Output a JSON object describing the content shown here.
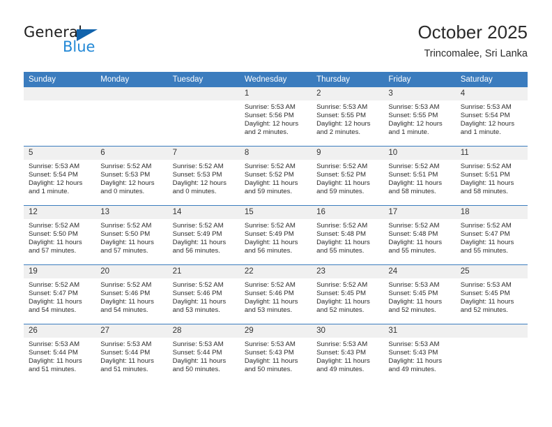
{
  "brand": {
    "name_top": "General",
    "name_bottom": "Blue",
    "accent_color": "#1163ac",
    "accent_color_light": "#2288d6"
  },
  "header": {
    "title": "October 2025",
    "subtitle": "Trincomalee, Sri Lanka"
  },
  "theme": {
    "header_row_bg": "#3b7cbe",
    "daynum_bg": "#f0f0f0",
    "text_color": "#2c2c2c"
  },
  "calendar": {
    "weekday_headers": [
      "Sunday",
      "Monday",
      "Tuesday",
      "Wednesday",
      "Thursday",
      "Friday",
      "Saturday"
    ],
    "weeks": [
      [
        {
          "day": "",
          "sunrise": "",
          "sunset": "",
          "daylight_line1": "",
          "daylight_line2": ""
        },
        {
          "day": "",
          "sunrise": "",
          "sunset": "",
          "daylight_line1": "",
          "daylight_line2": ""
        },
        {
          "day": "",
          "sunrise": "",
          "sunset": "",
          "daylight_line1": "",
          "daylight_line2": ""
        },
        {
          "day": "1",
          "sunrise": "Sunrise: 5:53 AM",
          "sunset": "Sunset: 5:56 PM",
          "daylight_line1": "Daylight: 12 hours",
          "daylight_line2": "and 2 minutes."
        },
        {
          "day": "2",
          "sunrise": "Sunrise: 5:53 AM",
          "sunset": "Sunset: 5:55 PM",
          "daylight_line1": "Daylight: 12 hours",
          "daylight_line2": "and 2 minutes."
        },
        {
          "day": "3",
          "sunrise": "Sunrise: 5:53 AM",
          "sunset": "Sunset: 5:55 PM",
          "daylight_line1": "Daylight: 12 hours",
          "daylight_line2": "and 1 minute."
        },
        {
          "day": "4",
          "sunrise": "Sunrise: 5:53 AM",
          "sunset": "Sunset: 5:54 PM",
          "daylight_line1": "Daylight: 12 hours",
          "daylight_line2": "and 1 minute."
        }
      ],
      [
        {
          "day": "5",
          "sunrise": "Sunrise: 5:53 AM",
          "sunset": "Sunset: 5:54 PM",
          "daylight_line1": "Daylight: 12 hours",
          "daylight_line2": "and 1 minute."
        },
        {
          "day": "6",
          "sunrise": "Sunrise: 5:52 AM",
          "sunset": "Sunset: 5:53 PM",
          "daylight_line1": "Daylight: 12 hours",
          "daylight_line2": "and 0 minutes."
        },
        {
          "day": "7",
          "sunrise": "Sunrise: 5:52 AM",
          "sunset": "Sunset: 5:53 PM",
          "daylight_line1": "Daylight: 12 hours",
          "daylight_line2": "and 0 minutes."
        },
        {
          "day": "8",
          "sunrise": "Sunrise: 5:52 AM",
          "sunset": "Sunset: 5:52 PM",
          "daylight_line1": "Daylight: 11 hours",
          "daylight_line2": "and 59 minutes."
        },
        {
          "day": "9",
          "sunrise": "Sunrise: 5:52 AM",
          "sunset": "Sunset: 5:52 PM",
          "daylight_line1": "Daylight: 11 hours",
          "daylight_line2": "and 59 minutes."
        },
        {
          "day": "10",
          "sunrise": "Sunrise: 5:52 AM",
          "sunset": "Sunset: 5:51 PM",
          "daylight_line1": "Daylight: 11 hours",
          "daylight_line2": "and 58 minutes."
        },
        {
          "day": "11",
          "sunrise": "Sunrise: 5:52 AM",
          "sunset": "Sunset: 5:51 PM",
          "daylight_line1": "Daylight: 11 hours",
          "daylight_line2": "and 58 minutes."
        }
      ],
      [
        {
          "day": "12",
          "sunrise": "Sunrise: 5:52 AM",
          "sunset": "Sunset: 5:50 PM",
          "daylight_line1": "Daylight: 11 hours",
          "daylight_line2": "and 57 minutes."
        },
        {
          "day": "13",
          "sunrise": "Sunrise: 5:52 AM",
          "sunset": "Sunset: 5:50 PM",
          "daylight_line1": "Daylight: 11 hours",
          "daylight_line2": "and 57 minutes."
        },
        {
          "day": "14",
          "sunrise": "Sunrise: 5:52 AM",
          "sunset": "Sunset: 5:49 PM",
          "daylight_line1": "Daylight: 11 hours",
          "daylight_line2": "and 56 minutes."
        },
        {
          "day": "15",
          "sunrise": "Sunrise: 5:52 AM",
          "sunset": "Sunset: 5:49 PM",
          "daylight_line1": "Daylight: 11 hours",
          "daylight_line2": "and 56 minutes."
        },
        {
          "day": "16",
          "sunrise": "Sunrise: 5:52 AM",
          "sunset": "Sunset: 5:48 PM",
          "daylight_line1": "Daylight: 11 hours",
          "daylight_line2": "and 55 minutes."
        },
        {
          "day": "17",
          "sunrise": "Sunrise: 5:52 AM",
          "sunset": "Sunset: 5:48 PM",
          "daylight_line1": "Daylight: 11 hours",
          "daylight_line2": "and 55 minutes."
        },
        {
          "day": "18",
          "sunrise": "Sunrise: 5:52 AM",
          "sunset": "Sunset: 5:47 PM",
          "daylight_line1": "Daylight: 11 hours",
          "daylight_line2": "and 55 minutes."
        }
      ],
      [
        {
          "day": "19",
          "sunrise": "Sunrise: 5:52 AM",
          "sunset": "Sunset: 5:47 PM",
          "daylight_line1": "Daylight: 11 hours",
          "daylight_line2": "and 54 minutes."
        },
        {
          "day": "20",
          "sunrise": "Sunrise: 5:52 AM",
          "sunset": "Sunset: 5:46 PM",
          "daylight_line1": "Daylight: 11 hours",
          "daylight_line2": "and 54 minutes."
        },
        {
          "day": "21",
          "sunrise": "Sunrise: 5:52 AM",
          "sunset": "Sunset: 5:46 PM",
          "daylight_line1": "Daylight: 11 hours",
          "daylight_line2": "and 53 minutes."
        },
        {
          "day": "22",
          "sunrise": "Sunrise: 5:52 AM",
          "sunset": "Sunset: 5:46 PM",
          "daylight_line1": "Daylight: 11 hours",
          "daylight_line2": "and 53 minutes."
        },
        {
          "day": "23",
          "sunrise": "Sunrise: 5:52 AM",
          "sunset": "Sunset: 5:45 PM",
          "daylight_line1": "Daylight: 11 hours",
          "daylight_line2": "and 52 minutes."
        },
        {
          "day": "24",
          "sunrise": "Sunrise: 5:53 AM",
          "sunset": "Sunset: 5:45 PM",
          "daylight_line1": "Daylight: 11 hours",
          "daylight_line2": "and 52 minutes."
        },
        {
          "day": "25",
          "sunrise": "Sunrise: 5:53 AM",
          "sunset": "Sunset: 5:45 PM",
          "daylight_line1": "Daylight: 11 hours",
          "daylight_line2": "and 52 minutes."
        }
      ],
      [
        {
          "day": "26",
          "sunrise": "Sunrise: 5:53 AM",
          "sunset": "Sunset: 5:44 PM",
          "daylight_line1": "Daylight: 11 hours",
          "daylight_line2": "and 51 minutes."
        },
        {
          "day": "27",
          "sunrise": "Sunrise: 5:53 AM",
          "sunset": "Sunset: 5:44 PM",
          "daylight_line1": "Daylight: 11 hours",
          "daylight_line2": "and 51 minutes."
        },
        {
          "day": "28",
          "sunrise": "Sunrise: 5:53 AM",
          "sunset": "Sunset: 5:44 PM",
          "daylight_line1": "Daylight: 11 hours",
          "daylight_line2": "and 50 minutes."
        },
        {
          "day": "29",
          "sunrise": "Sunrise: 5:53 AM",
          "sunset": "Sunset: 5:43 PM",
          "daylight_line1": "Daylight: 11 hours",
          "daylight_line2": "and 50 minutes."
        },
        {
          "day": "30",
          "sunrise": "Sunrise: 5:53 AM",
          "sunset": "Sunset: 5:43 PM",
          "daylight_line1": "Daylight: 11 hours",
          "daylight_line2": "and 49 minutes."
        },
        {
          "day": "31",
          "sunrise": "Sunrise: 5:53 AM",
          "sunset": "Sunset: 5:43 PM",
          "daylight_line1": "Daylight: 11 hours",
          "daylight_line2": "and 49 minutes."
        },
        {
          "day": "",
          "sunrise": "",
          "sunset": "",
          "daylight_line1": "",
          "daylight_line2": ""
        }
      ]
    ]
  }
}
